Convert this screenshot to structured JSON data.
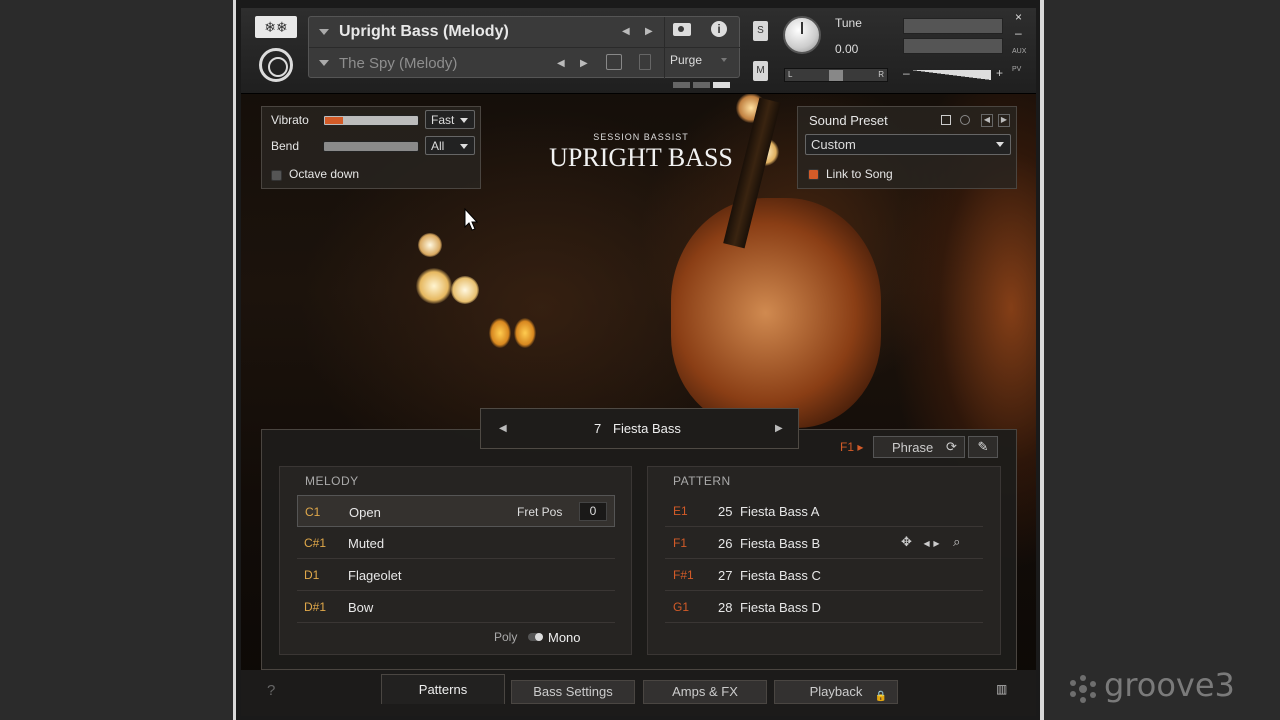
{
  "header": {
    "instrument_name": "Upright Bass (Melody)",
    "multi_name": "The Spy (Melody)",
    "purge_label": "Purge",
    "solo_label": "S",
    "mute_label": "M",
    "tune_label": "Tune",
    "tune_value": "0.00",
    "pan_left": "L",
    "pan_right": "R",
    "aux_label": "AUX",
    "pv_label": "PV",
    "close_label": "×",
    "minimize_label": "–",
    "vol_minus": "–",
    "vol_plus": "+"
  },
  "left_panel": {
    "vibrato_label": "Vibrato",
    "vibrato_value": "Fast",
    "bend_label": "Bend",
    "bend_value": "All",
    "octave_label": "Octave down"
  },
  "title": {
    "subtitle": "SESSION BASSIST",
    "main": "UPRIGHT BASS"
  },
  "right_panel": {
    "preset_label": "Sound Preset",
    "preset_value": "Custom",
    "link_label": "Link to Song"
  },
  "pattern_selector": {
    "number": "7",
    "name": "Fiesta Bass"
  },
  "toolbar": {
    "f1_label": "F1 ▸",
    "phrase_label": "Phrase"
  },
  "melody": {
    "title": "MELODY",
    "fret_pos_label": "Fret Pos",
    "fret_pos_value": "0",
    "rows": [
      {
        "key": "C1",
        "name": "Open"
      },
      {
        "key": "C#1",
        "name": "Muted"
      },
      {
        "key": "D1",
        "name": "Flageolet"
      },
      {
        "key": "D#1",
        "name": "Bow"
      }
    ],
    "poly_label": "Poly",
    "mono_label": "Mono"
  },
  "pattern": {
    "title": "PATTERN",
    "rows": [
      {
        "key": "E1",
        "num": "25",
        "name": "Fiesta Bass A"
      },
      {
        "key": "F1",
        "num": "26",
        "name": "Fiesta Bass B"
      },
      {
        "key": "F#1",
        "num": "27",
        "name": "Fiesta Bass C"
      },
      {
        "key": "G1",
        "num": "28",
        "name": "Fiesta Bass D"
      }
    ]
  },
  "tabs": {
    "help": "?",
    "patterns": "Patterns",
    "bass_settings": "Bass Settings",
    "amps_fx": "Amps & FX",
    "playback": "Playback"
  },
  "watermark": "groove3",
  "colors": {
    "accent": "#d35b28",
    "key_melody": "#e0a84a"
  }
}
